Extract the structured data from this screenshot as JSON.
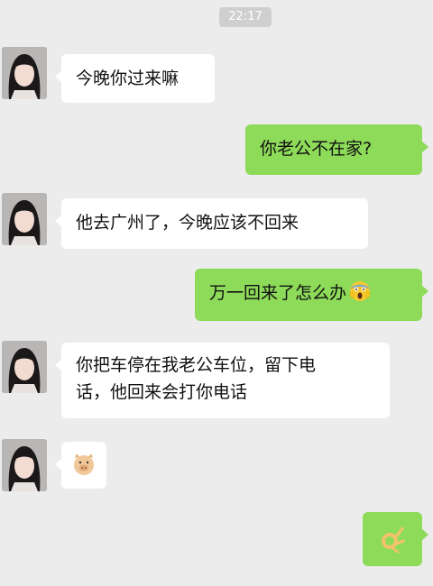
{
  "status": {
    "time": "22:17"
  },
  "messages": [
    {
      "side": "left",
      "text": "今晚你过来嘛"
    },
    {
      "side": "right",
      "text": "你老公不在家?"
    },
    {
      "side": "left",
      "text": "他去广州了，今晚应该不回来"
    },
    {
      "side": "right",
      "text": "万一回来了怎么办",
      "emoji": "scream-face-icon"
    },
    {
      "side": "left",
      "text_line1": "你把车停在我老公车位，留下电",
      "text_line2": "话，他回来会打你电话"
    },
    {
      "side": "left",
      "emoji": "pig-face-icon"
    },
    {
      "side": "right",
      "emoji": "ok-hand-icon"
    }
  ],
  "colors": {
    "background": "#ececec",
    "left_bubble": "#ffffff",
    "right_bubble": "#8edb5a"
  }
}
